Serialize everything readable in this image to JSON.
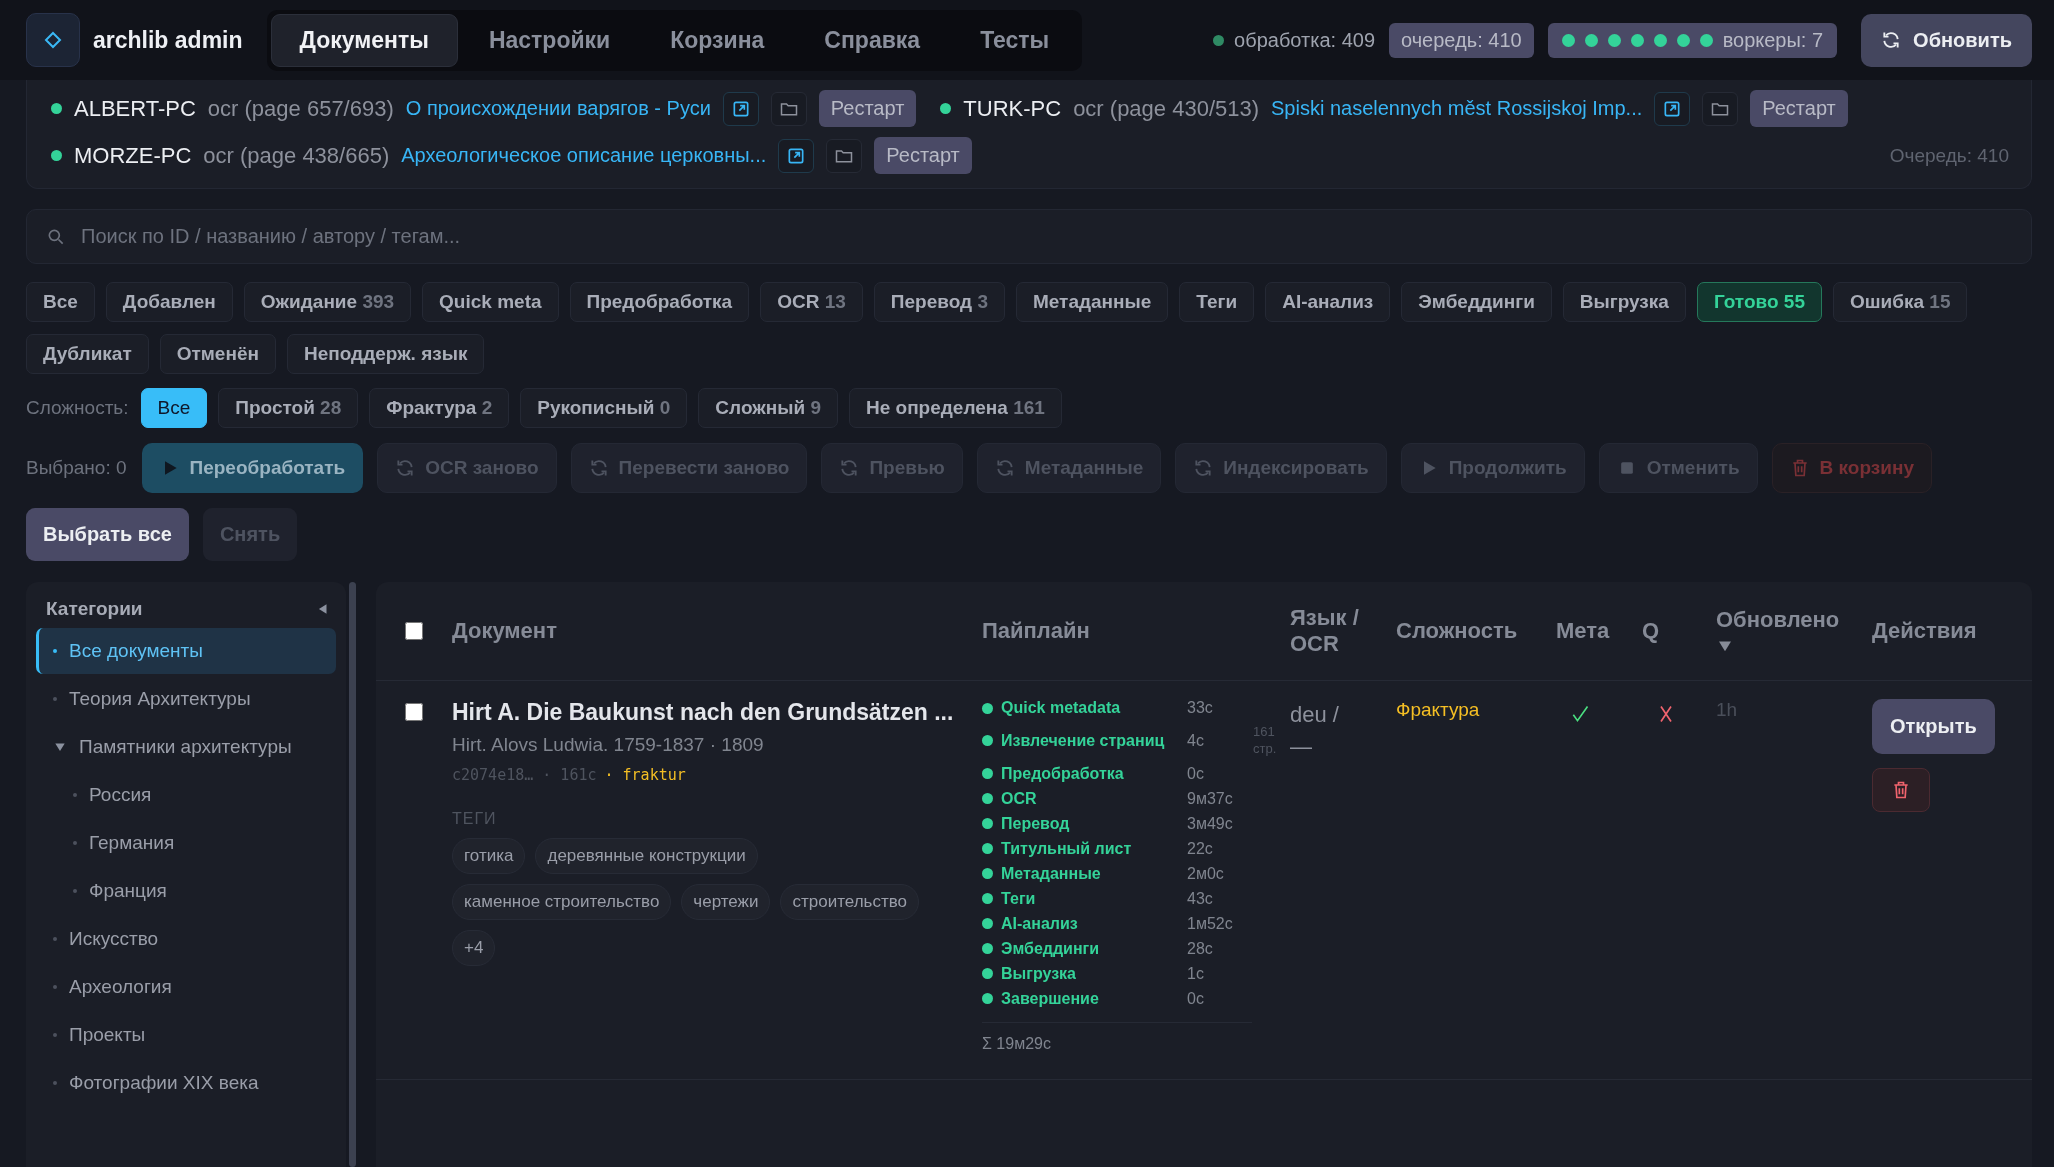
{
  "app": {
    "title": "archlib admin"
  },
  "tabs": [
    {
      "label": "Документы",
      "selected": true
    },
    {
      "label": "Настройки",
      "selected": false
    },
    {
      "label": "Корзина",
      "selected": false
    },
    {
      "label": "Справка",
      "selected": false
    },
    {
      "label": "Тесты",
      "selected": false
    }
  ],
  "status": {
    "processing": "обработка: 409",
    "queue": "очередь: 410",
    "workers": "воркеры: 7",
    "worker_dots": [
      {
        "active": true
      },
      {
        "active": true
      },
      {
        "active": true
      },
      {
        "active": true
      },
      {
        "active": true
      },
      {
        "active": true
      },
      {
        "active": true
      }
    ]
  },
  "refresh_button": "Обновить",
  "workers": [
    {
      "name": "ALBERT-PC",
      "online": true,
      "activity": "ocr (page 657/693)",
      "document": "О происхождении варягов - Руси",
      "restart": "Рестарт"
    },
    {
      "name": "TURK-PC",
      "online": true,
      "activity": "ocr (page 430/513)",
      "document": "Spiski naselennych měst Rossijskoj Imp...",
      "restart": "Рестарт"
    },
    {
      "name": "MORZE-PC",
      "online": true,
      "activity": "ocr (page 438/665)",
      "document": "Археологическое описание церковны...",
      "restart": "Рестарт"
    }
  ],
  "queue_note": "Очередь: 410",
  "search": {
    "placeholder": "Поиск по ID / названию / автору / тегам..."
  },
  "status_filters": [
    {
      "label": "Все",
      "selected": false
    },
    {
      "label": "Добавлен",
      "selected": false
    },
    {
      "label": "Ожидание",
      "count": "393",
      "selected": false
    },
    {
      "label": "Quick meta",
      "selected": false
    },
    {
      "label": "Предобработка",
      "selected": false
    },
    {
      "label": "OCR",
      "count": "13",
      "selected": false
    },
    {
      "label": "Перевод",
      "count": "3",
      "selected": false
    },
    {
      "label": "Метаданные",
      "selected": false
    },
    {
      "label": "Теги",
      "selected": false
    },
    {
      "label": "AI-анализ",
      "selected": false
    },
    {
      "label": "Эмбеддинги",
      "selected": false
    },
    {
      "label": "Выгрузка",
      "selected": false
    },
    {
      "label": "Готово",
      "count": "55",
      "selected": true
    },
    {
      "label": "Ошибка",
      "count": "15",
      "selected": false
    },
    {
      "label": "Дубликат",
      "selected": false
    },
    {
      "label": "Отменён",
      "selected": false
    },
    {
      "label": "Неподдерж. язык",
      "selected": false
    }
  ],
  "complexity_filter": {
    "label": "Сложность:",
    "options": [
      {
        "label": "Все",
        "selected": true
      },
      {
        "label": "Простой",
        "count": "28",
        "selected": false
      },
      {
        "label": "Фрактура",
        "count": "2",
        "selected": false
      },
      {
        "label": "Рукописный",
        "count": "0",
        "selected": false
      },
      {
        "label": "Сложный",
        "count": "9",
        "selected": false
      },
      {
        "label": "Не определена",
        "count": "161",
        "selected": false
      }
    ]
  },
  "bulk": {
    "selected_label": "Выбрано: 0",
    "actions": [
      {
        "label": "Переобработать",
        "kind": "primary"
      },
      {
        "label": "OCR заново",
        "kind": "muted"
      },
      {
        "label": "Перевести заново",
        "kind": "muted"
      },
      {
        "label": "Превью",
        "kind": "muted"
      },
      {
        "label": "Метаданные",
        "kind": "muted"
      },
      {
        "label": "Индексировать",
        "kind": "muted"
      },
      {
        "label": "Продолжить",
        "kind": "muted"
      },
      {
        "label": "Отменить",
        "kind": "muted"
      },
      {
        "label": "В корзину",
        "kind": "danger"
      }
    ]
  },
  "select_all": {
    "label": "Выбрать все",
    "disabled": false
  },
  "clear": {
    "label": "Снять",
    "disabled": true
  },
  "sidebar": {
    "title": "Категории",
    "items": [
      {
        "label": "Все документы",
        "selected": true
      },
      {
        "label": "Теория Архитектуры",
        "selected": false
      },
      {
        "label": "Памятники архитектуры",
        "selected": false,
        "expanded": true,
        "children": [
          {
            "label": "Россия",
            "selected": false
          },
          {
            "label": "Германия",
            "selected": false
          },
          {
            "label": "Франция",
            "selected": false
          }
        ]
      },
      {
        "label": "Искусство",
        "selected": false
      },
      {
        "label": "Археология",
        "selected": false
      },
      {
        "label": "Проекты",
        "selected": false
      },
      {
        "label": "Фотографии XIX века",
        "selected": false
      }
    ]
  },
  "table": {
    "columns": [
      {
        "label": "Документ"
      },
      {
        "label": "Пайплайн"
      },
      {
        "label": "Язык / OCR"
      },
      {
        "label": "Сложность"
      },
      {
        "label": "Мета"
      },
      {
        "label": "Q"
      },
      {
        "label": "Обновлено",
        "sorted": true
      },
      {
        "label": "Действия"
      }
    ],
    "all_checked": false,
    "rows": [
      {
        "checked": false,
        "title": "Hirt A. Die Baukunst nach den Grundsätzen ...",
        "author": "Hirt. Alovs Ludwia. 1759-1837 · 1809",
        "meta": "c2074e18… · 161с",
        "script": "· fraktur",
        "tags_label": "ТЕГИ",
        "tags": [
          "готика",
          "деревянные конструкции",
          "каменное строительство",
          "чертежи",
          "строительство"
        ],
        "more_tags": "+4",
        "pipeline": [
          {
            "name": "Quick metadata",
            "time": "33с",
            "done": true
          },
          {
            "name": "Извлечение страниц",
            "time": "4с",
            "note": "161 стр.",
            "done": true
          },
          {
            "name": "Предобработка",
            "time": "0с",
            "done": true
          },
          {
            "name": "OCR",
            "time": "9м37с",
            "done": true
          },
          {
            "name": "Перевод",
            "time": "3м49с",
            "done": true
          },
          {
            "name": "Титульный лист",
            "time": "22с",
            "done": true
          },
          {
            "name": "Метаданные",
            "time": "2м0с",
            "done": true
          },
          {
            "name": "Теги",
            "time": "43с",
            "done": true
          },
          {
            "name": "AI-анализ",
            "time": "1м52с",
            "done": true
          },
          {
            "name": "Эмбеддинги",
            "time": "28с",
            "done": true
          },
          {
            "name": "Выгрузка",
            "time": "1с",
            "done": true
          },
          {
            "name": "Завершение",
            "time": "0с",
            "done": true
          }
        ],
        "total": "Σ 19м29с",
        "language": "deu / —",
        "complexity": "Фрактура",
        "meta_ok": true,
        "q_ok": false,
        "updated": "1h",
        "open_button": "Открыть"
      }
    ]
  }
}
